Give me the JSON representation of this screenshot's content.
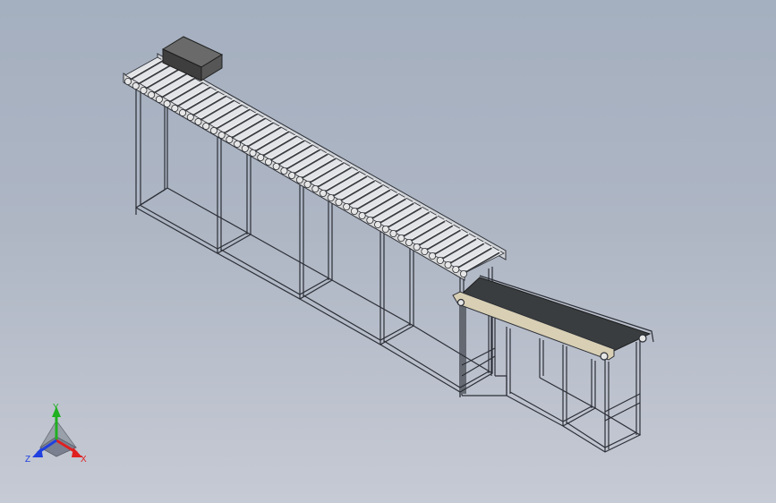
{
  "viewport": {
    "background_top": "#a4afbf",
    "background_bottom": "#c6cad4"
  },
  "model": {
    "components": [
      {
        "name": "roller-conveyor",
        "type": "gravity roller conveyor"
      },
      {
        "name": "belt-conveyor",
        "type": "belt conveyor"
      },
      {
        "name": "carton-box",
        "type": "box load"
      }
    ],
    "colors": {
      "frame": "#2c2f36",
      "rail": "#d9d9d9",
      "roller": "#e6e6e6",
      "belt": "#3a3d3f",
      "belt_side": "#d8cfb4",
      "box": "#4a4a4a"
    }
  },
  "triad": {
    "x_label": "X",
    "y_label": "Y",
    "z_label": "Z",
    "x_color": "#e02020",
    "y_color": "#20b020",
    "z_color": "#2040e0"
  }
}
